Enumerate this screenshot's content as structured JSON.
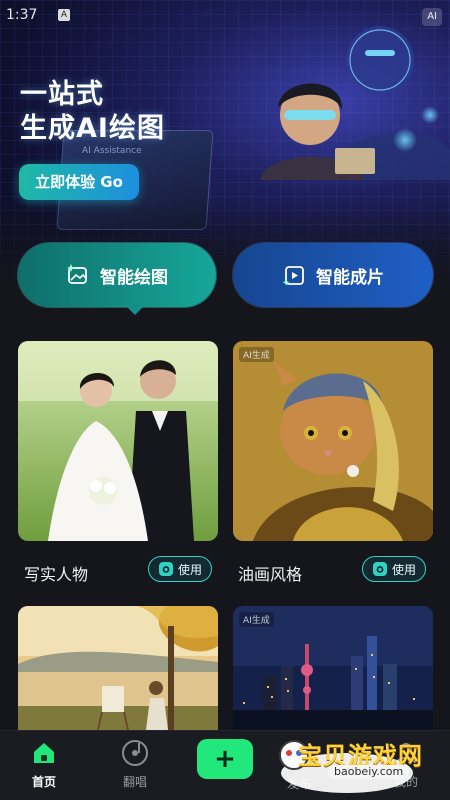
{
  "status_bar": {
    "time": "1:37",
    "indicator": "A"
  },
  "hero": {
    "badge": "AI",
    "title_line1": "一站式",
    "title_line2": "生成AI绘图",
    "cta_label": "立即体验 Go",
    "laptop_text": "AI Assistance"
  },
  "features": {
    "draw_label": "智能绘图",
    "video_label": "智能成片"
  },
  "cards": [
    {
      "title": "写实人物",
      "use_label": "使用"
    },
    {
      "title": "油画风格",
      "use_label": "使用",
      "tag": "AI生成"
    },
    {
      "title": "",
      "use_label": ""
    },
    {
      "title": "",
      "use_label": "",
      "tag": "AI生成"
    }
  ],
  "tabbar": {
    "home": "首页",
    "cover": "翻唱",
    "center_hidden": "发布",
    "mine": "我的"
  },
  "watermark": {
    "text": "宝贝游戏网",
    "url": "baobeiy.com"
  },
  "colors": {
    "accent_green": "#22e77a",
    "teal": "#17a79a",
    "blue": "#1f5fc6",
    "background": "#15161c"
  },
  "icons": {
    "draw": "image-sparkle-icon",
    "video": "play-sparkle-icon",
    "use": "camera-icon",
    "home": "home-icon",
    "cover": "vinyl-note-icon",
    "publish": "plus-icon"
  }
}
